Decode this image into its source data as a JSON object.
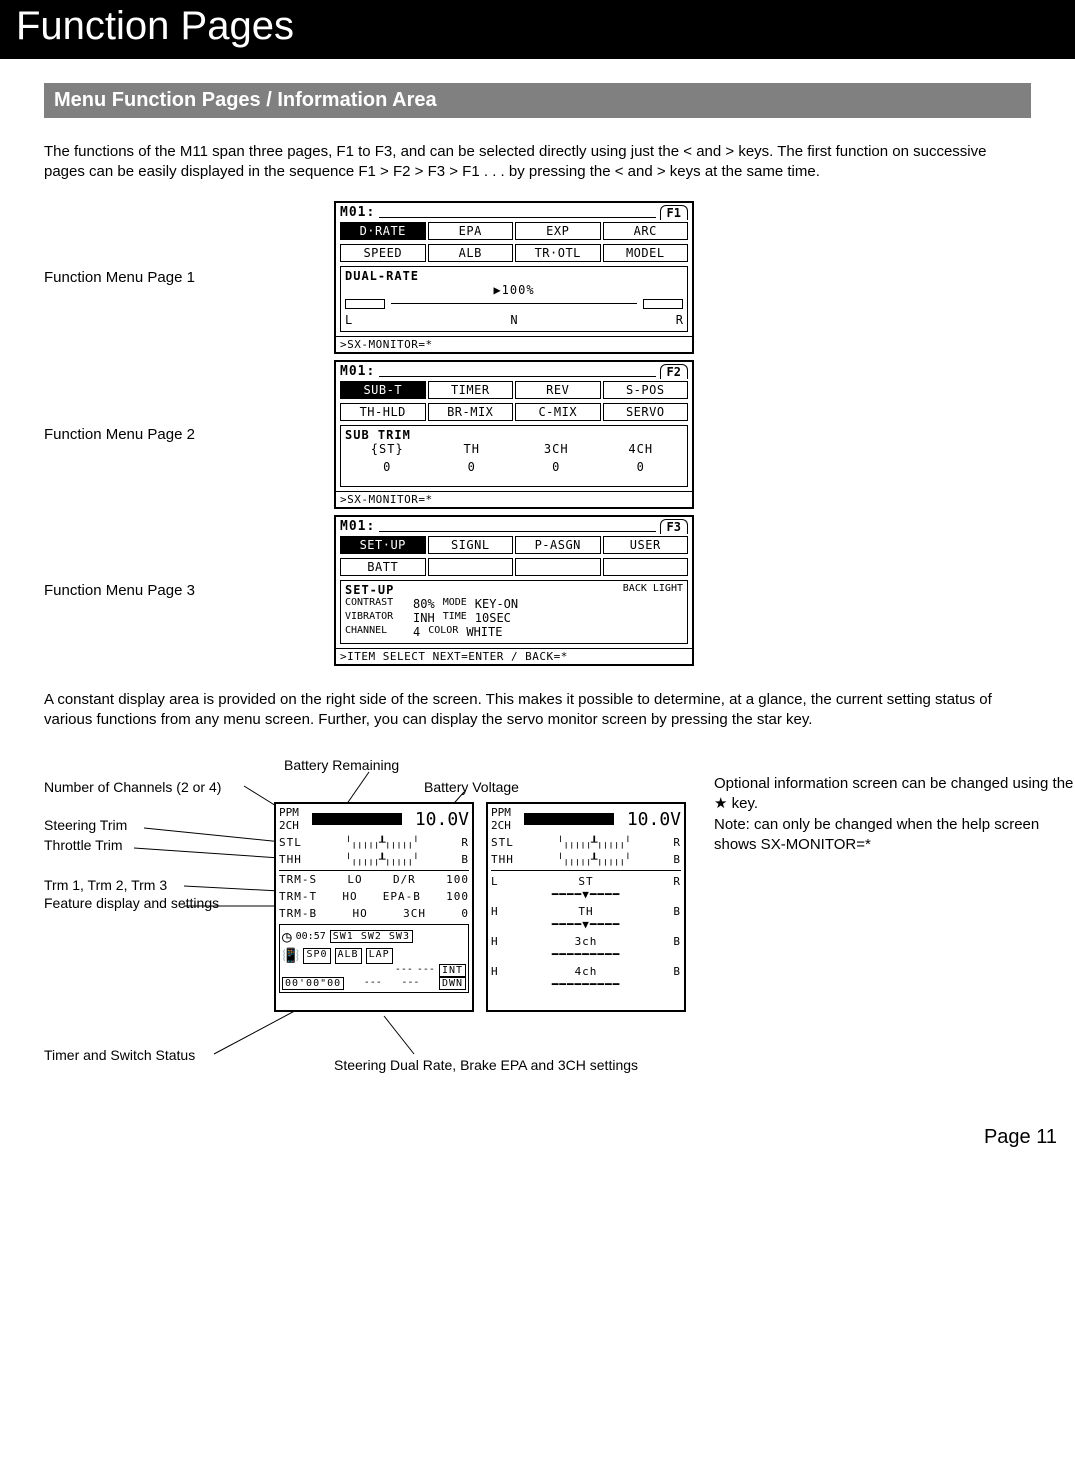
{
  "page_title": "Function Pages",
  "section_title": "Menu Function Pages / Information Area",
  "intro_text": "The functions of the M11 span three pages, F1 to F3, and can be selected directly using just the < and > keys. The first function on successive pages can be easily displayed in the sequence F1 > F2 > F3 > F1 . . . by pressing the < and > keys at the same time.",
  "menu_pages": {
    "p1": {
      "label": "Function Menu Page 1",
      "model": "M01:",
      "tab": "F1",
      "row1": [
        "D·RATE",
        "EPA",
        "EXP",
        "ARC"
      ],
      "row2": [
        "SPEED",
        "ALB",
        "TR·OTL",
        "MODEL"
      ],
      "panel_hdr": "DUAL-RATE",
      "panel_val": "▶100%",
      "panel_l": "L",
      "panel_n": "N",
      "panel_r": "R",
      "foot": ">SX-MONITOR=*"
    },
    "p2": {
      "label": "Function Menu Page 2",
      "model": "M01:",
      "tab": "F2",
      "row1": [
        "SUB-T",
        "TIMER",
        "REV",
        "S-POS"
      ],
      "row2": [
        "TH-HLD",
        "BR-MIX",
        "C-MIX",
        "SERVO"
      ],
      "panel_hdr": "SUB TRIM",
      "cols": [
        "{ST}",
        "TH",
        "3CH",
        "4CH"
      ],
      "vals": [
        "0",
        "0",
        "0",
        "0"
      ],
      "foot": ">SX-MONITOR=*"
    },
    "p3": {
      "label": "Function Menu Page 3",
      "model": "M01:",
      "tab": "F3",
      "row1": [
        "SET·UP",
        "SIGNL",
        "P-ASGN",
        "USER"
      ],
      "row2": [
        "BATT",
        "",
        "",
        ""
      ],
      "panel_hdr": "SET-UP",
      "bl_hdr": "BACK LIGHT",
      "c_lbl": "CONTRAST",
      "c_val": "80%",
      "bl_mode_l": "MODE",
      "bl_mode_v": "KEY-ON",
      "v_lbl": "VIBRATOR",
      "v_val": "INH",
      "bl_time_l": "TIME",
      "bl_time_v": "10SEC",
      "ch_lbl": "CHANNEL",
      "ch_val": "4",
      "bl_col_l": "COLOR",
      "bl_col_v": "WHITE",
      "foot": ">ITEM SELECT NEXT=ENTER / BACK=*"
    }
  },
  "mid_text": "A constant display area is provided on the right side of the screen. This makes it possible to determine, at a glance, the current setting status of various functions from any menu screen. Further, you can display the servo monitor screen by pressing the star key.",
  "callouts": {
    "batt_remaining": "Battery Remaining",
    "batt_voltage": "Battery Voltage",
    "channels": "Number of Channels (2 or 4)",
    "st_trim": "Steering Trim",
    "th_trim": "Throttle Trim",
    "trm123": "Trm 1, Trm 2, Trm 3",
    "feature": "Feature display and settings",
    "timer": "Timer and Switch Status",
    "bottom_caption": "Steering Dual Rate, Brake EPA and 3CH settings"
  },
  "right_note_1": "Optional information screen can be changed using the ",
  "right_note_star": "★",
  "right_note_2": " key.",
  "right_note_3": "Note: can only be changed when the help screen shows SX-MONITOR=*",
  "info_lcd": {
    "ppm": "PPM",
    "ch": "2CH",
    "volts": "10.0V",
    "st": "STL",
    "th": "THH",
    "st_r": "R",
    "th_r": "B",
    "trm_s": "TRM-S",
    "trm_t": "TRM-T",
    "trm_b": "TRM-B",
    "trm_s_m": "LO",
    "trm_s_f": "D/R",
    "trm_s_v": "100",
    "trm_t_m": "HO",
    "trm_t_f": "EPA-B",
    "trm_t_v": "100",
    "trm_b_m": "HO",
    "trm_b_f": "3CH",
    "trm_b_v": "0",
    "clock": "00:57",
    "sw": "SW1 SW2 SW3",
    "sp": "SP0",
    "alb": "ALB",
    "lap": "LAP",
    "int": "INT",
    "dwn": "DWN",
    "timer": "00'00\"00"
  },
  "info_lcd2": {
    "ppm": "PPM",
    "ch": "2CH",
    "volts": "10.0V",
    "st": "STL",
    "st_r": "R",
    "th": "THH",
    "th_r": "B",
    "l": "L",
    "st_c": "ST",
    "r": "R",
    "h1": "H",
    "th_c": "TH",
    "b1": "B",
    "ch3": "3ch",
    "ch4": "4ch"
  },
  "page_number": "Page 11"
}
